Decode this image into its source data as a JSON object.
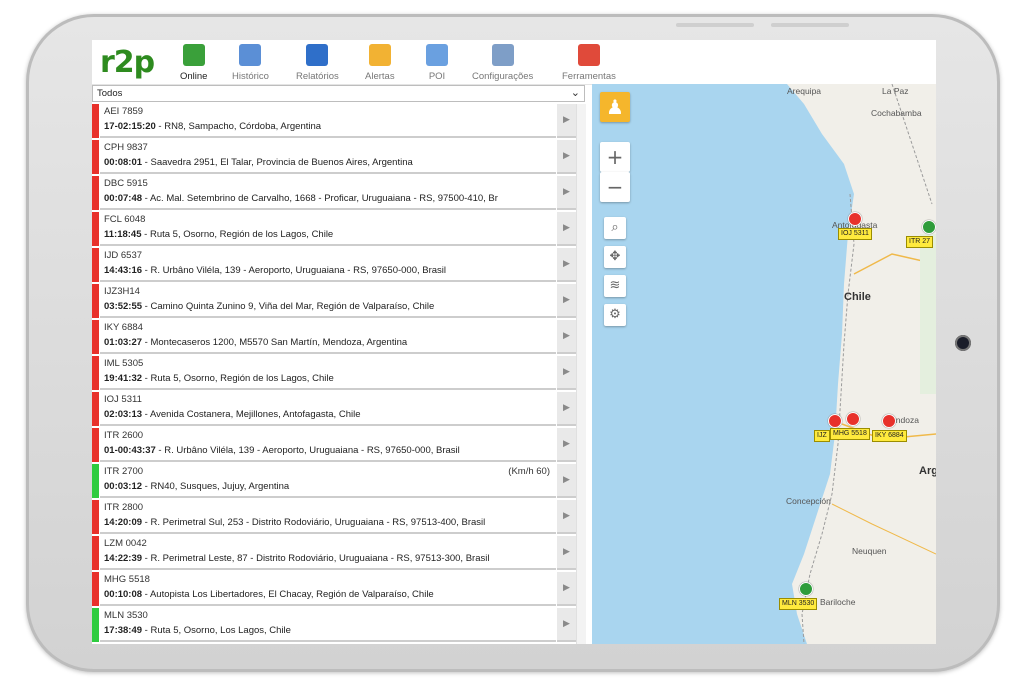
{
  "app": {
    "logo": "r2p"
  },
  "toolbar": [
    {
      "label": "Online",
      "icon": "online-icon",
      "color": "#3aa03a",
      "active": true
    },
    {
      "label": "Histórico",
      "icon": "history-icon",
      "color": "#5b8fd6",
      "active": false
    },
    {
      "label": "Relatórios",
      "icon": "reports-icon",
      "color": "#2f6fc9",
      "active": false
    },
    {
      "label": "Alertas",
      "icon": "alert-bell-icon",
      "color": "#f2b233",
      "active": false
    },
    {
      "label": "POI",
      "icon": "poi-icon",
      "color": "#6aa0e0",
      "active": false
    },
    {
      "label": "Configurações",
      "icon": "settings-icon",
      "color": "#7e9ec7",
      "active": false
    },
    {
      "label": "Ferramentas",
      "icon": "tools-icon",
      "color": "#e04a3a",
      "active": false
    }
  ],
  "filter": {
    "value": "Todos"
  },
  "vehicles": [
    {
      "plate": "AEI 7859",
      "time": "17-02:15:20",
      "address": "RN8, Sampacho, Córdoba, Argentina",
      "status": "#e8312b",
      "speed": ""
    },
    {
      "plate": "CPH 9837",
      "time": "00:08:01",
      "address": "Saavedra 2951, El Talar, Provincia de Buenos Aires, Argentina",
      "status": "#e8312b",
      "speed": ""
    },
    {
      "plate": "DBC 5915",
      "time": "00:07:48",
      "address": "Ac. Mal. Setembrino de Carvalho, 1668 - Proficar, Uruguaiana - RS, 97500-410, Br",
      "status": "#e8312b",
      "speed": ""
    },
    {
      "plate": "FCL 6048",
      "time": "11:18:45",
      "address": "Ruta 5, Osorno, Región de los Lagos, Chile",
      "status": "#e8312b",
      "speed": ""
    },
    {
      "plate": "IJD 6537",
      "time": "14:43:16",
      "address": "R. Urbâno Viléla, 139 - Aeroporto, Uruguaiana - RS, 97650-000, Brasil",
      "status": "#e8312b",
      "speed": ""
    },
    {
      "plate": "IJZ3H14",
      "time": "03:52:55",
      "address": "Camino Quinta Zunino 9, Viña del Mar, Región de Valparaíso, Chile",
      "status": "#e8312b",
      "speed": ""
    },
    {
      "plate": "IKY 6884",
      "time": "01:03:27",
      "address": "Montecaseros 1200, M5570 San Martín, Mendoza, Argentina",
      "status": "#e8312b",
      "speed": ""
    },
    {
      "plate": "IML 5305",
      "time": "19:41:32",
      "address": "Ruta 5, Osorno, Región de los Lagos, Chile",
      "status": "#e8312b",
      "speed": ""
    },
    {
      "plate": "IOJ 5311",
      "time": "02:03:13",
      "address": "Avenida Costanera, Mejillones, Antofagasta, Chile",
      "status": "#e8312b",
      "speed": ""
    },
    {
      "plate": "ITR 2600",
      "time": "01-00:43:37",
      "address": "R. Urbâno Viléla, 139 - Aeroporto, Uruguaiana - RS, 97650-000, Brasil",
      "status": "#e8312b",
      "speed": ""
    },
    {
      "plate": "ITR 2700",
      "time": "00:03:12",
      "address": "RN40, Susques, Jujuy, Argentina",
      "status": "#2ecc40",
      "speed": "(Km/h 60)"
    },
    {
      "plate": "ITR 2800",
      "time": "14:20:09",
      "address": "R. Perimetral Sul, 253 - Distrito Rodoviário, Uruguaiana - RS, 97513-400, Brasil",
      "status": "#e8312b",
      "speed": ""
    },
    {
      "plate": "LZM 0042",
      "time": "14:22:39",
      "address": "R. Perimetral Leste, 87 - Distrito Rodoviário, Uruguaiana - RS, 97513-300, Brasil",
      "status": "#e8312b",
      "speed": ""
    },
    {
      "plate": "MHG 5518",
      "time": "00:10:08",
      "address": "Autopista Los Libertadores, El Chacay, Región de Valparaíso, Chile",
      "status": "#e8312b",
      "speed": ""
    },
    {
      "plate": "MLN 3530",
      "time": "17:38:49",
      "address": "Ruta 5, Osorno, Los Lagos, Chile",
      "status": "#2ecc40",
      "speed": ""
    }
  ],
  "map": {
    "places": [
      {
        "name": "Arequipa",
        "cls": ""
      },
      {
        "name": "La Paz",
        "cls": ""
      },
      {
        "name": "Cochabamba",
        "cls": ""
      },
      {
        "name": "Antofagasta",
        "cls": ""
      },
      {
        "name": "Chile",
        "cls": "big"
      },
      {
        "name": "Mendoza",
        "cls": ""
      },
      {
        "name": "Arg",
        "cls": "big"
      },
      {
        "name": "Concepción",
        "cls": ""
      },
      {
        "name": "Neuquen",
        "cls": ""
      },
      {
        "name": "Bariloche",
        "cls": ""
      }
    ],
    "markers": [
      {
        "label": "IOJ 5311",
        "color": "#e8312b"
      },
      {
        "label": "ITR 27",
        "color": "#2e9c3a"
      },
      {
        "label": "IJZ",
        "color": "#e8312b"
      },
      {
        "label": "MHG 5518",
        "color": "#e8312b"
      },
      {
        "label": "IKY 6884",
        "color": "#e8312b"
      },
      {
        "label": "MLN 3530",
        "color": "#2e9c3a"
      }
    ]
  }
}
